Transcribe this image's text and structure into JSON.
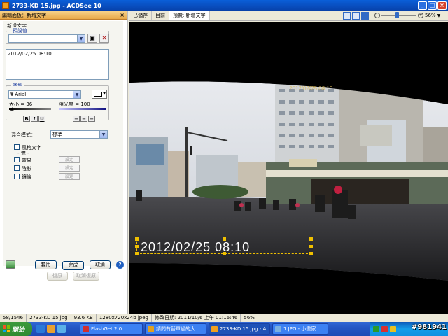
{
  "window": {
    "title": "2733-KD  15.jpg - ACDSee 10"
  },
  "panel": {
    "header": "編輯面板：新增文字",
    "section_title": "新增文字",
    "preset_group": "預設值",
    "preset_value": "",
    "text_content": "2012/02/25 08:10",
    "font_group": "字型",
    "font_name": "Arial",
    "size_label": "大小 = 36",
    "opacity_label": "阻光度 = 100",
    "bold": "B",
    "italic": "I",
    "underline": "U",
    "blend_label": "混合模式：",
    "blend_value": "標準",
    "fit_text": "風格文字",
    "fit_sub": "- 遮 -",
    "effect_label": "效果",
    "shadow_label": "陰影",
    "bevel_label": "鑲線",
    "settings_label": "設定",
    "apply": "套用",
    "done": "完成",
    "cancel": "取消",
    "undo": "復原",
    "redo": "取消復原",
    "help": "?"
  },
  "tabs": [
    "已儲存",
    "目前",
    "預覽: 新增文字"
  ],
  "zoom": {
    "value": "56%"
  },
  "overlay": {
    "timestamp": "2012/02/25 08:10"
  },
  "status": {
    "index": "58/1546",
    "filename": "2733-KD  15.jpg",
    "size": "93.6 KB",
    "dims": "1280x720x24b jpeg",
    "modified": "修改日期: 2011/10/6 上午 01:16:46",
    "zoom": "56%"
  },
  "taskbar": {
    "start": "開始",
    "items": [
      "FlashGet 2.0",
      "請問有替單過的大...",
      "2733-KD 15.jpg - A...",
      "1.JPG - 小畫家"
    ],
    "watermark": "#981941"
  },
  "colors": {
    "accent": "#316ac5",
    "timestamp_box": "#f0c000",
    "panel_header": "#e8a848"
  }
}
